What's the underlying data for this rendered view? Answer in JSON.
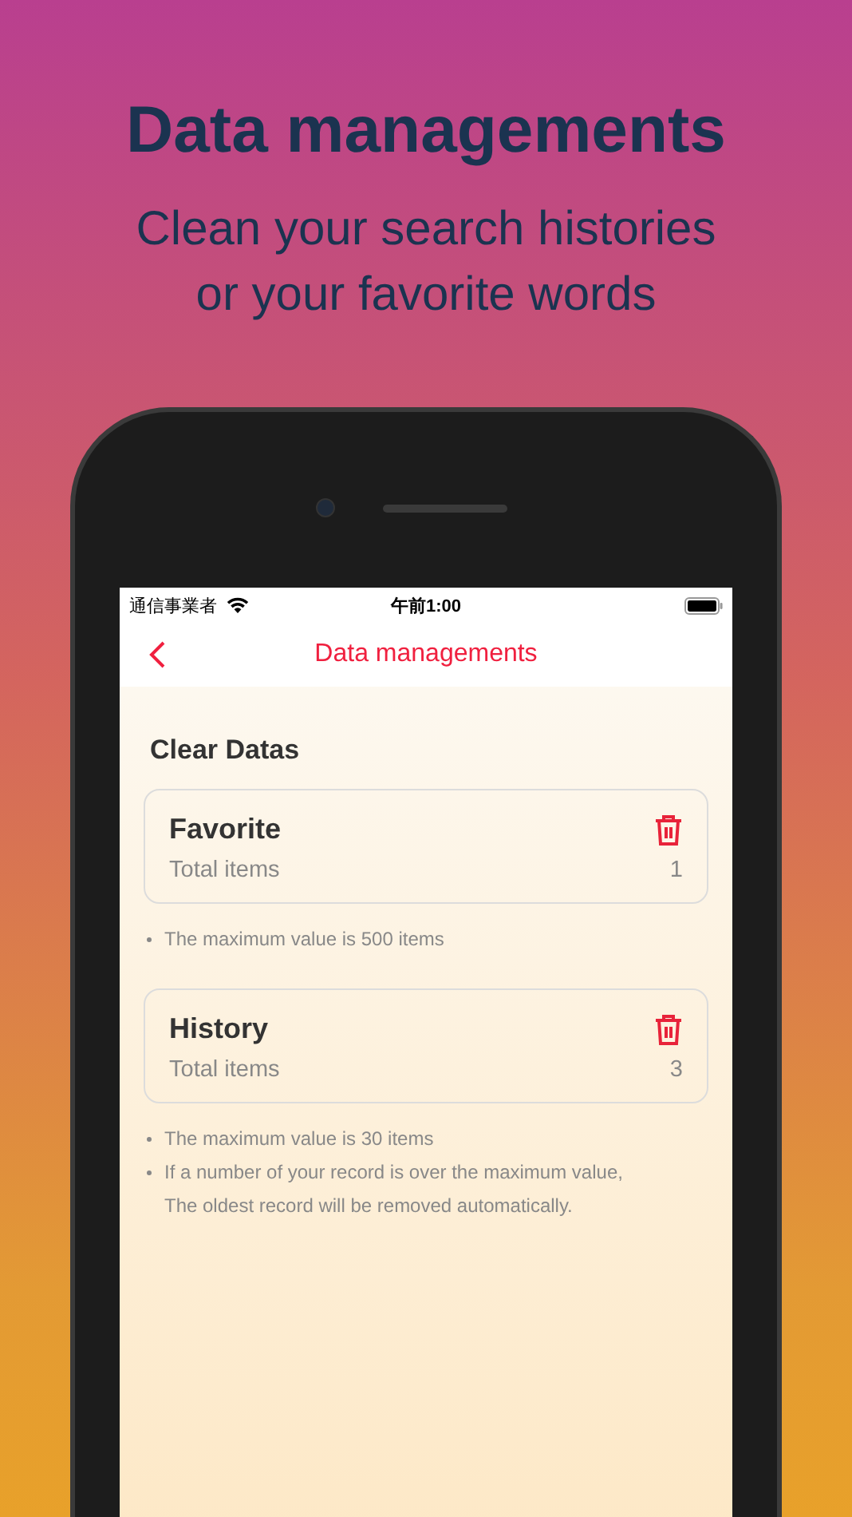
{
  "headline": "Data managements",
  "subheadline": "Clean your search histories\nor your favorite words",
  "status_bar": {
    "carrier": "通信事業者",
    "time": "午前1:00"
  },
  "nav": {
    "title": "Data managements"
  },
  "section_title": "Clear Datas",
  "cards": [
    {
      "title": "Favorite",
      "label": "Total items",
      "count": "1",
      "notes": [
        "The maximum value is 500 items"
      ]
    },
    {
      "title": "History",
      "label": "Total items",
      "count": "3",
      "notes": [
        "The maximum value is 30 items",
        "If a number of your record is over the maximum value, The oldest record will be removed automatically."
      ]
    }
  ]
}
